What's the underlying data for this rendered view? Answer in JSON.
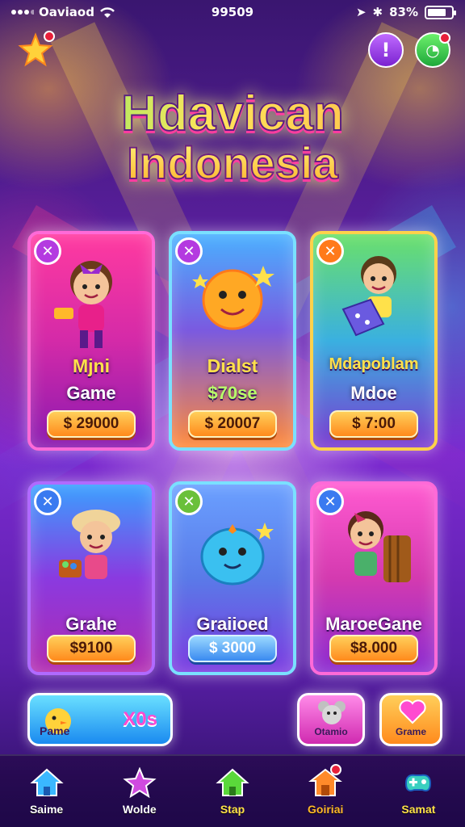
{
  "status_bar": {
    "carrier": "Oaviaod",
    "time": "99509",
    "battery": "83%"
  },
  "title": {
    "line1": "Hdavican",
    "line2": "Indonesia"
  },
  "cards": [
    {
      "name1": "Mjni",
      "name2": "Game",
      "price": "$ 29000"
    },
    {
      "name1": "Dialst",
      "name2": "$70se",
      "price": "$ 20007"
    },
    {
      "name1": "Mdapoblam",
      "name2": "Mdoe",
      "price": "$ 7:00"
    }
  ],
  "cards_row2": [
    {
      "name": "Grahe",
      "price": "$9100"
    },
    {
      "name": "Graiioed",
      "price": "$ 3000"
    },
    {
      "name": "MaroeGane",
      "price": "$8.000"
    }
  ],
  "promo": {
    "left_label": "Pame",
    "left_badge": "X0s",
    "mid_label": "Otamio",
    "right_label": "Grame"
  },
  "bottom_nav": [
    {
      "label": "Saime",
      "icon": "home-icon"
    },
    {
      "label": "Wolde",
      "icon": "star-icon"
    },
    {
      "label": "Stap",
      "icon": "home-icon"
    },
    {
      "label": "Goiriai",
      "icon": "shop-icon"
    },
    {
      "label": "Samat",
      "icon": "game-icon"
    }
  ],
  "colors": {
    "accent_yellow": "#ffe14a",
    "price_orange": "#ff8a1c",
    "price_blue": "#3a8af0"
  }
}
